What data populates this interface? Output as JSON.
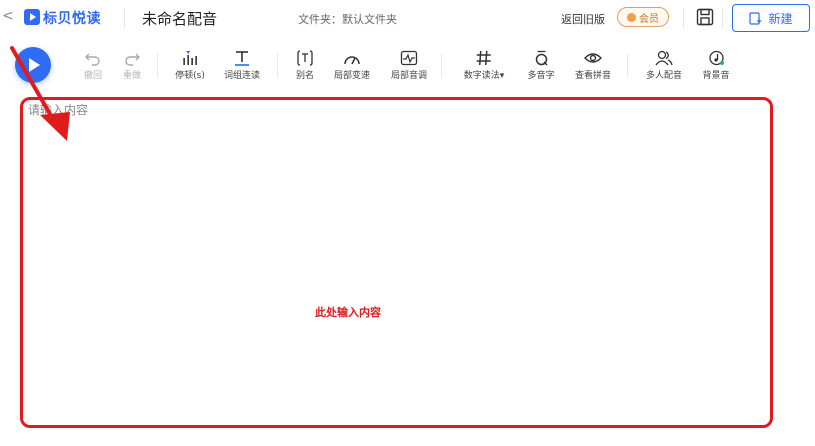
{
  "header": {
    "back_glyph": "<",
    "logo_text": "标贝悦读",
    "doc_title": "未命名配音",
    "folder": "文件夹：默认文件夹",
    "old_version": "返回旧版",
    "vip": "会员",
    "new_label": "新建"
  },
  "toolbar": {
    "undo": "撤回",
    "redo": "重做",
    "pause": "停顿(s)",
    "word_group": "词组连读",
    "alias": "别名",
    "local_speed": "局部变速",
    "local_pitch": "局部音调",
    "number_reading": "数字读法",
    "polyphone": "多音字",
    "pinyin": "查看拼音",
    "multi_voice": "多人配音",
    "bgm": "背景音"
  },
  "editor": {
    "placeholder": "请输入内容",
    "hint": "此处输入内容"
  },
  "colors": {
    "primary": "#2f6bf5",
    "annotation_red": "#e01b1b",
    "vip_orange": "#e0a060"
  }
}
